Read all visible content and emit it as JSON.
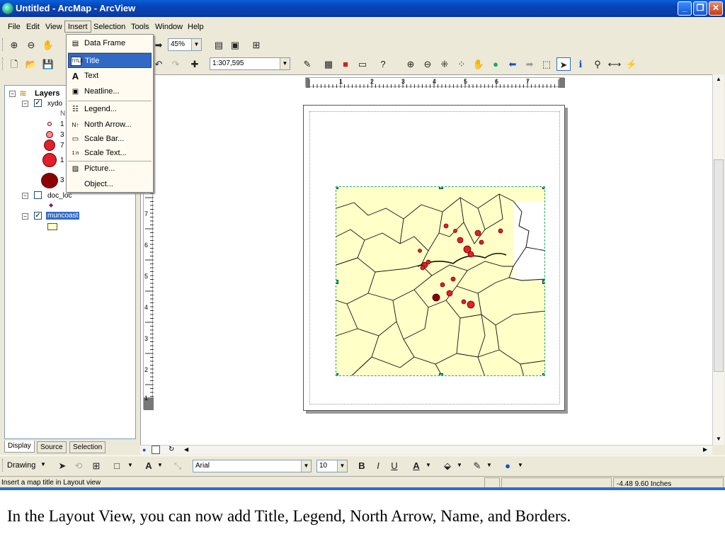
{
  "window": {
    "title": "Untitled - ArcMap - ArcView",
    "controls": [
      "_",
      "❐",
      "✕"
    ]
  },
  "menubar": {
    "items": [
      "File",
      "Edit",
      "View",
      "Insert",
      "Selection",
      "Tools",
      "Window",
      "Help"
    ]
  },
  "toolbar1": {
    "zoom_value": "45%"
  },
  "toolbar2": {
    "scale_value": "1:307,595"
  },
  "toc": {
    "root_label": "Layers",
    "layers": [
      {
        "name": "xydo",
        "checked": true,
        "legend": [
          "N",
          "1",
          "3",
          "7",
          "1",
          "3"
        ]
      },
      {
        "name": "doc_loc",
        "checked": false
      },
      {
        "name": "muncoast",
        "checked": true,
        "selected": true
      }
    ],
    "tabs": [
      "Display",
      "Source",
      "Selection"
    ],
    "active_tab": "Display"
  },
  "insert_menu": {
    "items": [
      {
        "label": "Data Frame",
        "icon": "data-frame-icon",
        "glyph": "▤"
      },
      {
        "label": "Title",
        "icon": "title-icon",
        "glyph": "TITLE",
        "selected": true
      },
      {
        "label": "Text",
        "icon": "text-icon",
        "glyph": "A"
      },
      {
        "label": "Neatline...",
        "icon": "neatline-icon",
        "glyph": "▣"
      },
      {
        "label": "Legend...",
        "icon": "legend-icon",
        "glyph": "☷"
      },
      {
        "label": "North Arrow...",
        "icon": "north-arrow-icon",
        "glyph": "N↑"
      },
      {
        "label": "Scale Bar...",
        "icon": "scale-bar-icon",
        "glyph": "▭"
      },
      {
        "label": "Scale Text...",
        "icon": "scale-text-icon",
        "glyph": "1:n"
      },
      {
        "label": "Picture...",
        "icon": "picture-icon",
        "glyph": "▨"
      },
      {
        "label": "Object...",
        "icon": "object-icon",
        "glyph": ""
      }
    ]
  },
  "ruler": {
    "h_ticks": [
      "1",
      "2",
      "3",
      "4",
      "5",
      "6",
      "7"
    ],
    "v_ticks": [
      "7",
      "6",
      "5",
      "4",
      "3",
      "2",
      "1"
    ]
  },
  "drawing_toolbar": {
    "drawing_label": "Drawing",
    "font": "Arial",
    "size": "10",
    "bold": "B",
    "italic": "I",
    "underline": "U",
    "font_color": "A"
  },
  "statusbar": {
    "message": "Insert a map title in Layout view",
    "coordinates": "-4.48  9.60 Inches"
  },
  "caption": "In the Layout View, you can now add Title, Legend, North Arrow, Name, and Borders.",
  "colors": {
    "title_blue": "#0a47c6",
    "map_fill": "#ffffc8",
    "selection_blue": "#316ac5",
    "point_red": "#e0202a",
    "point_dark": "#8b0000"
  }
}
